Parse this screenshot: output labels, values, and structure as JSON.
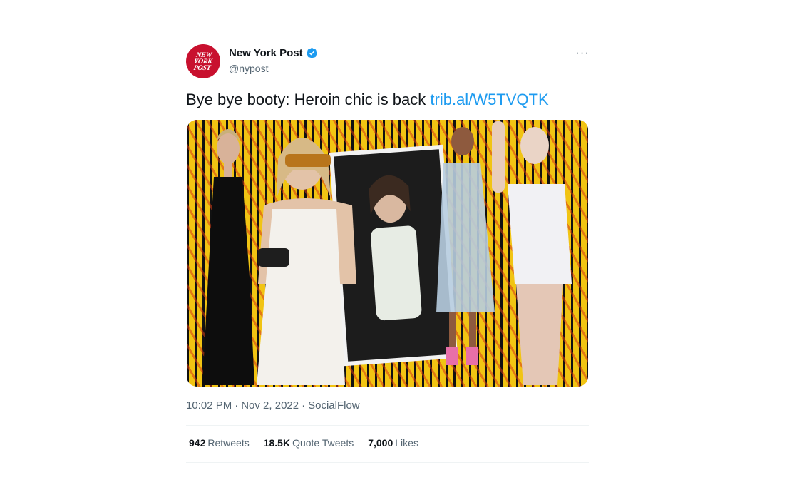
{
  "account": {
    "avatar_lines": [
      "NEW",
      "YORK",
      "POST"
    ],
    "display_name": "New York Post",
    "handle": "@nypost",
    "verified_icon": "verified-badge-icon"
  },
  "tweet": {
    "text": "Bye bye booty: Heroin chic is back ",
    "link": "trib.al/W5TVQTK"
  },
  "meta": {
    "time": "10:02 PM",
    "sep1": "·",
    "date": "Nov 2, 2022",
    "sep2": "·",
    "source": "SocialFlow"
  },
  "stats": [
    {
      "value": "942",
      "label": "Retweets"
    },
    {
      "value": "18.5K",
      "label": "Quote Tweets"
    },
    {
      "value": "7,000",
      "label": "Likes"
    }
  ],
  "colors": {
    "link": "#1d9bf0",
    "verified": "#1d9bf0",
    "brand_red": "#c8102e",
    "muted": "#536471"
  },
  "more_icon": "···"
}
